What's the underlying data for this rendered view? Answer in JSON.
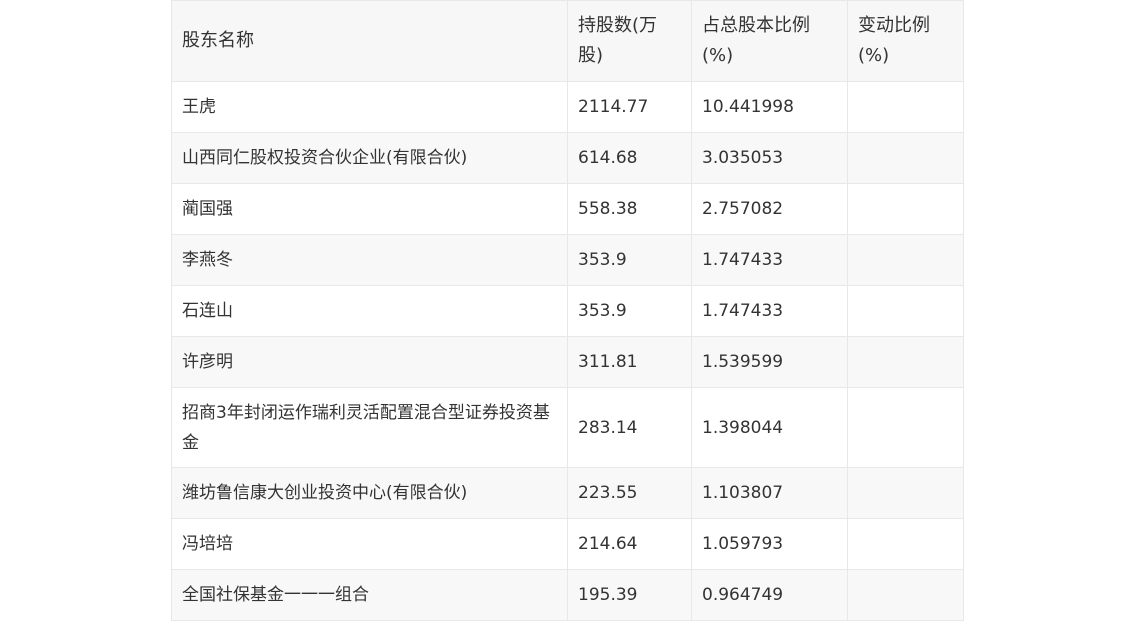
{
  "table": {
    "headers": [
      "股东名称",
      "持股数(万股)",
      "占总股本比例(%)",
      "变动比例(%)"
    ],
    "rows": [
      {
        "name": "王虎",
        "shares": "2114.77",
        "ratio": "10.441998",
        "change": ""
      },
      {
        "name": "山西同仁股权投资合伙企业(有限合伙)",
        "shares": "614.68",
        "ratio": "3.035053",
        "change": ""
      },
      {
        "name": "蔺国强",
        "shares": "558.38",
        "ratio": "2.757082",
        "change": ""
      },
      {
        "name": "李燕冬",
        "shares": "353.9",
        "ratio": "1.747433",
        "change": ""
      },
      {
        "name": "石连山",
        "shares": "353.9",
        "ratio": "1.747433",
        "change": ""
      },
      {
        "name": "许彦明",
        "shares": "311.81",
        "ratio": "1.539599",
        "change": ""
      },
      {
        "name": "招商3年封闭运作瑞利灵活配置混合型证券投资基金",
        "shares": "283.14",
        "ratio": "1.398044",
        "change": ""
      },
      {
        "name": "潍坊鲁信康大创业投资中心(有限合伙)",
        "shares": "223.55",
        "ratio": "1.103807",
        "change": ""
      },
      {
        "name": "冯培培",
        "shares": "214.64",
        "ratio": "1.059793",
        "change": ""
      },
      {
        "name": "全国社保基金一一一组合",
        "shares": "195.39",
        "ratio": "0.964749",
        "change": ""
      }
    ]
  }
}
